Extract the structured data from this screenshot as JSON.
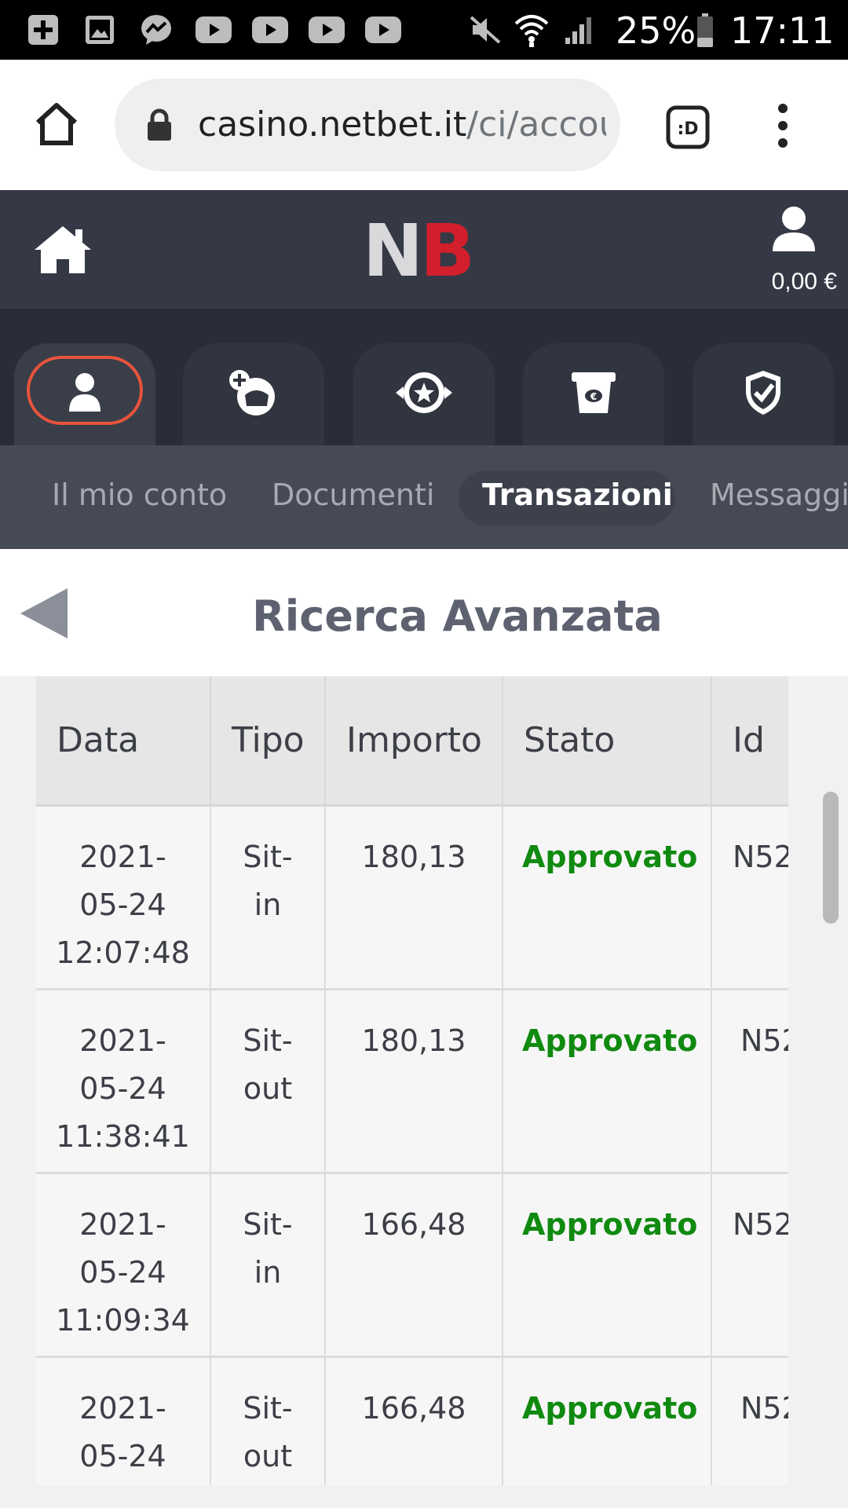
{
  "status_bar": {
    "battery": "25%",
    "time": "17:11",
    "left_icons": [
      "add-box-icon",
      "image-icon",
      "messenger-icon",
      "youtube-icon",
      "youtube-icon",
      "youtube-icon",
      "youtube-icon"
    ],
    "right_icons": [
      "mute-icon",
      "wifi-icon",
      "signal-icon",
      "battery-icon"
    ]
  },
  "browser": {
    "url_host": "casino.netbet.it",
    "url_path": "/ci/account",
    "icons": [
      "home-icon",
      "lock-icon",
      "tab-switcher-icon",
      "menu-dots-icon"
    ]
  },
  "header": {
    "logo_n": "N",
    "logo_b": "B",
    "balance": "0,00 €",
    "brand_colors": {
      "logo_n": "#d9d9dc",
      "logo_b": "#d21f2b",
      "header_bg": "#353945"
    }
  },
  "icon_tabs": [
    "account-icon",
    "deposit-icon",
    "bonus-star-icon",
    "withdraw-icon",
    "security-shield-icon"
  ],
  "sub_nav": {
    "items": [
      "Il mio conto",
      "Documenti",
      "Transazioni",
      "Messaggi"
    ],
    "active": "Transazioni"
  },
  "page": {
    "title": "Ricerca Avanzata"
  },
  "table": {
    "headers": [
      "Data",
      "Tipo",
      "Importo",
      "Stato",
      "Id"
    ],
    "rows": [
      {
        "date": "2021-",
        "date2": "05-24",
        "time": "12:07:48",
        "tipo": "Sit-",
        "tipo2": "in",
        "importo": "180,13",
        "stato": "Approvato",
        "id": "N52"
      },
      {
        "date": "2021-",
        "date2": "05-24",
        "time": "11:38:41",
        "tipo": "Sit-",
        "tipo2": "out",
        "importo": "180,13",
        "stato": "Approvato",
        "id": "N52"
      },
      {
        "date": "2021-",
        "date2": "05-24",
        "time": "11:09:34",
        "tipo": "Sit-",
        "tipo2": "in",
        "importo": "166,48",
        "stato": "Approvato",
        "id": "N52"
      },
      {
        "date": "2021-",
        "date2": "05-24",
        "time": "",
        "tipo": "Sit-",
        "tipo2": "out",
        "importo": "166,48",
        "stato": "Approvato",
        "id": "N52"
      }
    ],
    "status_color": "#108a10"
  }
}
